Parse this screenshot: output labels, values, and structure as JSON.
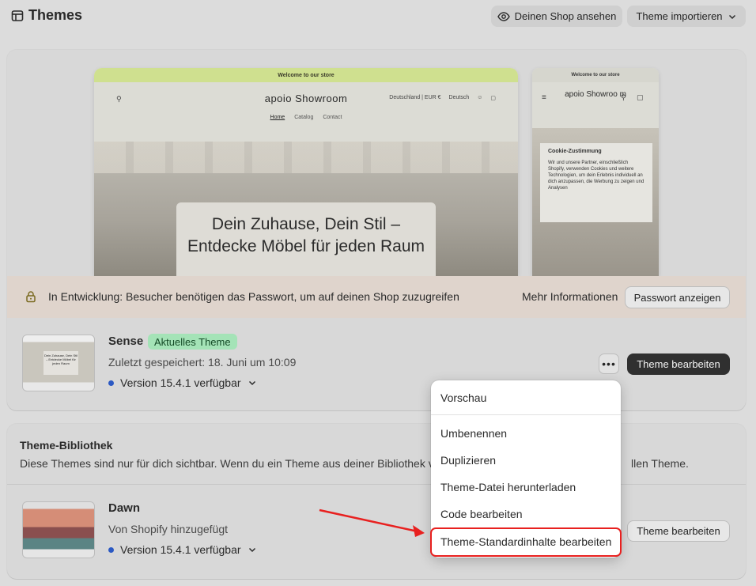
{
  "header": {
    "title": "Themes",
    "view_shop_label": "Deinen Shop ansehen",
    "import_label": "Theme importieren"
  },
  "preview": {
    "announcement": "Welcome to our store",
    "store_name": "apoio Showroom",
    "region": "Deutschland | EUR €",
    "language": "Deutsch",
    "nav": [
      "Home",
      "Catalog",
      "Contact"
    ],
    "hero_text": "Dein Zuhause, Dein Stil – Entdecke Möbel für jeden Raum",
    "mobile_store_name": "apoio Showroo m",
    "cookie_title": "Cookie-Zustimmung",
    "cookie_text": "Wir und unsere Partner, einschließlich Shopify, verwenden Cookies und weitere Technologien, um dein Erlebnis individuell an dich anzupassen, die Werbung zu zeigen und Analysen"
  },
  "banner": {
    "text": "In Entwicklung: Besucher benötigen das Passwort, um auf deinen Shop zuzugreifen",
    "more_info": "Mehr Informationen",
    "button": "Passwort anzeigen"
  },
  "current_theme": {
    "name": "Sense",
    "badge": "Aktuelles Theme",
    "saved": "Zuletzt gespeichert: 18. Juni um 10:09",
    "version": "Version 15.4.1 verfügbar",
    "more_label": "•••",
    "edit_label": "Theme bearbeiten",
    "thumb_text": "Dein Zuhause, Dein Stil – Entdecke Möbel für jeden Raum"
  },
  "library": {
    "title": "Theme-Bibliothek",
    "description": "Diese Themes sind nur für dich sichtbar. Wenn du ein Theme aus deiner Bibliothek v",
    "description_end": "llen Theme.",
    "themes": [
      {
        "name": "Dawn",
        "added": "Von Shopify hinzugefügt",
        "version": "Version 15.4.1 verfügbar",
        "edit_label": "Theme bearbeiten"
      }
    ]
  },
  "menu": {
    "items": [
      "Vorschau",
      "Umbenennen",
      "Duplizieren",
      "Theme-Datei herunterladen",
      "Code bearbeiten",
      "Theme-Standardinhalte bearbeiten"
    ],
    "highlight_color": "#e8201f"
  }
}
